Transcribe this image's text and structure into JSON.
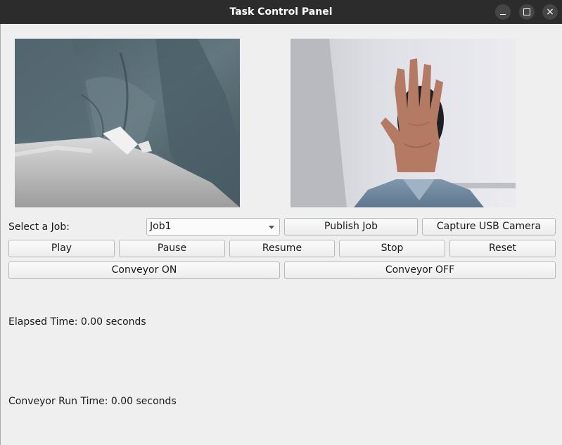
{
  "window": {
    "title": "Task Control Panel",
    "controls": {
      "minimize_icon": "minimize-icon",
      "maximize_icon": "maximize-icon",
      "close_icon": "close-icon",
      "close_glyph": "×"
    }
  },
  "job": {
    "label": "Select a Job:",
    "selected": "Job1",
    "publish_label": "Publish Job",
    "capture_label": "Capture USB Camera"
  },
  "controls": {
    "play_label": "Play",
    "pause_label": "Pause",
    "resume_label": "Resume",
    "stop_label": "Stop",
    "reset_label": "Reset"
  },
  "conveyor": {
    "on_label": "Conveyor ON",
    "off_label": "Conveyor OFF"
  },
  "status": {
    "elapsed": "Elapsed Time: 0.00 seconds",
    "conveyor_run": "Conveyor Run Time: 0.00 seconds"
  },
  "colors": {
    "titlebar": "#2c2c2c",
    "window_bg": "#efefef",
    "denim": "#5b6f78"
  }
}
